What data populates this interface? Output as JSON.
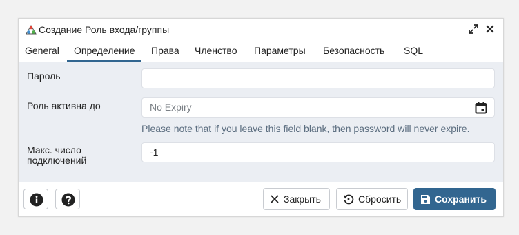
{
  "dialog": {
    "title": "Создание Роль входа/группы",
    "icon": "role-icon",
    "maximize_icon": "expand-icon",
    "close_icon": "close-icon"
  },
  "tabs": [
    {
      "label": "General"
    },
    {
      "label": "Определение"
    },
    {
      "label": "Права"
    },
    {
      "label": "Членство"
    },
    {
      "label": "Параметры"
    },
    {
      "label": "Безопасность"
    },
    {
      "label": "SQL"
    }
  ],
  "active_tab": "Определение",
  "form": {
    "password": {
      "label": "Пароль",
      "value": ""
    },
    "expiry": {
      "label": "Роль активна до",
      "placeholder": "No Expiry",
      "hint": "Please note that if you leave this field blank, then password will never expire.",
      "icon": "calendar-icon"
    },
    "conn_limit": {
      "label_line1": "Макс. число",
      "label_line2": "подключений",
      "value": "-1"
    }
  },
  "footer": {
    "info_icon": "info-icon",
    "help_icon": "help-icon",
    "close_label": "Закрыть",
    "reset_label": "Сбросить",
    "save_label": "Сохранить"
  },
  "colors": {
    "accent": "#326690",
    "form_bg": "#ebeef3",
    "hint_text": "#5c6e80"
  }
}
